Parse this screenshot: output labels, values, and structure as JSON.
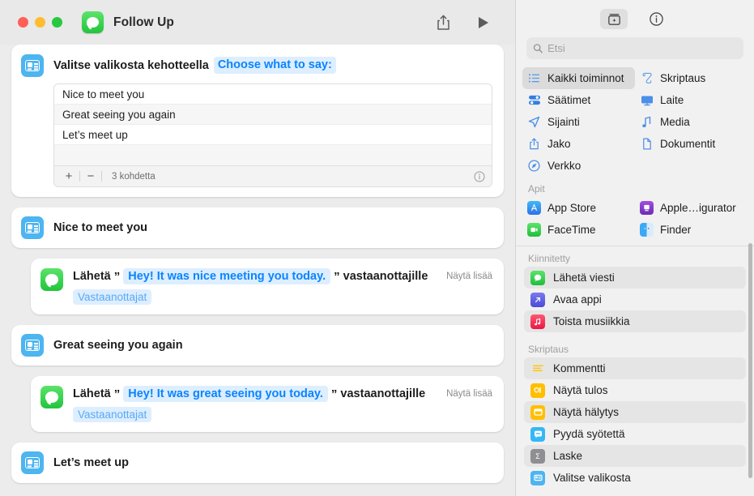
{
  "window": {
    "title": "Follow Up",
    "traffic_lights": [
      "close",
      "minimize",
      "zoom"
    ],
    "toolbar": {
      "share_label": "share-icon",
      "run_label": "run-icon"
    }
  },
  "editor": {
    "menu_action": {
      "title": "Valitse valikosta kehotteella",
      "prompt_token": "Choose what to say:",
      "items": [
        "Nice to meet you",
        "Great seeing you again",
        "Let’s meet up"
      ],
      "footer": {
        "add": "+",
        "remove": "−",
        "count": "3 kohdetta",
        "info": "info-icon"
      }
    },
    "branches": [
      {
        "header": "Nice to meet you",
        "send_prefix": "Lähetä",
        "open_quote": "”",
        "message": "Hey! It was nice meeting you today.",
        "close_quote": "”",
        "send_suffix": "vastaanottajille",
        "show_more": "Näytä lisää",
        "recipients_token": "Vastaanottajat"
      },
      {
        "header": "Great seeing you again",
        "send_prefix": "Lähetä",
        "open_quote": "”",
        "message": "Hey! It was great seeing you today.",
        "close_quote": "”",
        "send_suffix": "vastaanottajille",
        "show_more": "Näytä lisää",
        "recipients_token": "Vastaanottajat"
      },
      {
        "header": "Let’s meet up"
      }
    ]
  },
  "library": {
    "tabs": [
      {
        "name": "action-library-tab",
        "icon": "library-box-icon",
        "active": true
      },
      {
        "name": "info-tab",
        "icon": "info-circle-icon",
        "active": false
      }
    ],
    "search": {
      "placeholder": "Etsi",
      "value": "",
      "icon": "search-icon"
    },
    "categories": [
      {
        "label": "Kaikki toiminnot",
        "icon": "list-bullet-icon",
        "color": "#5a9fe8",
        "selected": true
      },
      {
        "label": "Skriptaus",
        "icon": "scroll-icon",
        "color": "#5a9fe8",
        "selected": false
      },
      {
        "label": "Säätimet",
        "icon": "sliders-icon",
        "color": "#2f7fe0",
        "selected": false
      },
      {
        "label": "Laite",
        "icon": "display-icon",
        "color": "#4b8fe8",
        "selected": false
      },
      {
        "label": "Sijainti",
        "icon": "location-arrow-icon",
        "color": "#4b8fe8",
        "selected": false
      },
      {
        "label": "Media",
        "icon": "music-note-icon",
        "color": "#4b8fe8",
        "selected": false
      },
      {
        "label": "Jako",
        "icon": "share-icon",
        "color": "#4b8fe8",
        "selected": false
      },
      {
        "label": "Dokumentit",
        "icon": "document-icon",
        "color": "#4b8fe8",
        "selected": false
      },
      {
        "label": "Verkko",
        "icon": "safari-compass-icon",
        "color": "#4b8fe8",
        "selected": false
      }
    ],
    "apps_section": {
      "heading": "Apit",
      "items": [
        {
          "label": "App Store",
          "icon": "app-store-icon",
          "color": "#3b8ef0"
        },
        {
          "label": "Apple…igurator",
          "icon": "apple-configurator-icon",
          "color": "#7b3fc4"
        },
        {
          "label": "FaceTime",
          "icon": "facetime-icon",
          "color": "#4cd964"
        },
        {
          "label": "Finder",
          "icon": "finder-icon",
          "color": "#2c9bf5"
        }
      ]
    },
    "pinned_section": {
      "heading": "Kiinnitetty",
      "items": [
        {
          "label": "Lähetä viesti",
          "icon": "messages-icon",
          "color": "#31c651",
          "zebra": true
        },
        {
          "label": "Avaa appi",
          "icon": "open-app-icon",
          "color": "#5b5be0",
          "zebra": false
        },
        {
          "label": "Toista musiikkia",
          "icon": "music-play-icon",
          "color": "#f4315b",
          "zebra": true
        }
      ]
    },
    "scripting_section": {
      "heading": "Skriptaus",
      "items": [
        {
          "label": "Kommentti",
          "icon": "comment-lines-icon",
          "color": "#ffffff",
          "zebra": true
        },
        {
          "label": "Näytä tulos",
          "icon": "show-result-icon",
          "color": "#ffbf00",
          "zebra": false
        },
        {
          "label": "Näytä hälytys",
          "icon": "show-alert-icon",
          "color": "#ffbf00",
          "zebra": true
        },
        {
          "label": "Pyydä syötettä",
          "icon": "ask-input-icon",
          "color": "#35b8f5",
          "zebra": false
        },
        {
          "label": "Laske",
          "icon": "calculate-sigma-icon",
          "color": "#8e8e93",
          "zebra": true
        },
        {
          "label": "Valitse valikosta",
          "icon": "choose-from-menu-icon",
          "color": "#4db5f0",
          "zebra": false
        }
      ]
    }
  },
  "colors": {
    "accent_blue": "#0a84ff",
    "token_bg": "#ddeeff",
    "messages_green": "#31c651",
    "menu_action_blue": "#4db5f0",
    "window_bg": "#ececec",
    "sidebar_bg": "#f2f1f1"
  }
}
